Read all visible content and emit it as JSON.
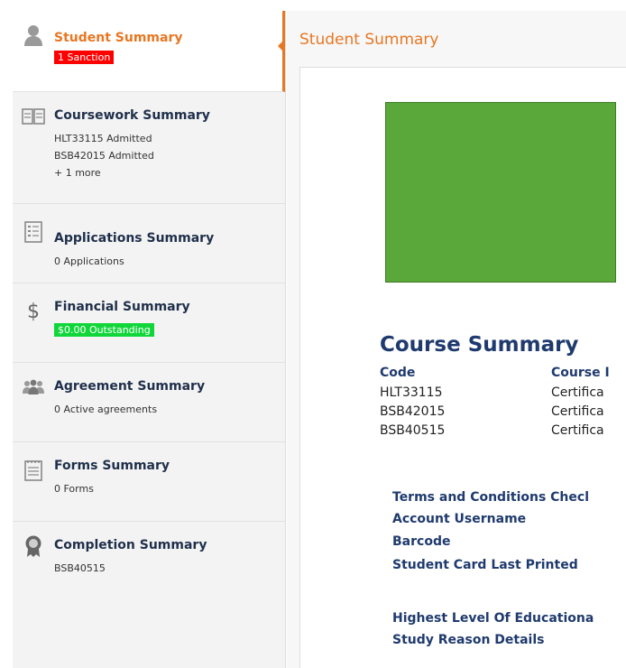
{
  "sidebar": {
    "items": [
      {
        "title": "Student Summary",
        "badge": "1 Sanction",
        "badge_color": "#ff0000",
        "icon": "person-icon",
        "active": true
      },
      {
        "title": "Coursework Summary",
        "lines": [
          "HLT33115 Admitted",
          "BSB42015 Admitted",
          "+ 1 more"
        ],
        "icon": "book-icon"
      },
      {
        "title": "Applications Summary",
        "lines": [
          "0 Applications"
        ],
        "icon": "document-list-icon"
      },
      {
        "title": "Financial Summary",
        "badge": "$0.00 Outstanding",
        "badge_color": "#10d63a",
        "icon": "dollar-icon"
      },
      {
        "title": "Agreement Summary",
        "lines": [
          "0 Active agreements"
        ],
        "icon": "group-icon"
      },
      {
        "title": "Forms Summary",
        "lines": [
          "0 Forms"
        ],
        "icon": "notepad-icon"
      },
      {
        "title": "Completion Summary",
        "lines": [
          "BSB40515"
        ],
        "icon": "award-icon"
      }
    ]
  },
  "main": {
    "title": "Student Summary",
    "course_summary": {
      "heading": "Course Summary",
      "columns": [
        "Code",
        "Course I"
      ],
      "rows": [
        [
          "HLT33115",
          "Certifica"
        ],
        [
          "BSB42015",
          "Certifica"
        ],
        [
          "BSB40515",
          "Certifica"
        ]
      ]
    },
    "details": [
      "Terms and Conditions Checl",
      "Account Username",
      "Barcode",
      "Student Card Last Printed",
      "Highest Level Of Educationa",
      "Study Reason Details"
    ]
  },
  "colors": {
    "accent": "#e87722",
    "heading": "#1f3a6e",
    "photo": "#5aa83a"
  }
}
